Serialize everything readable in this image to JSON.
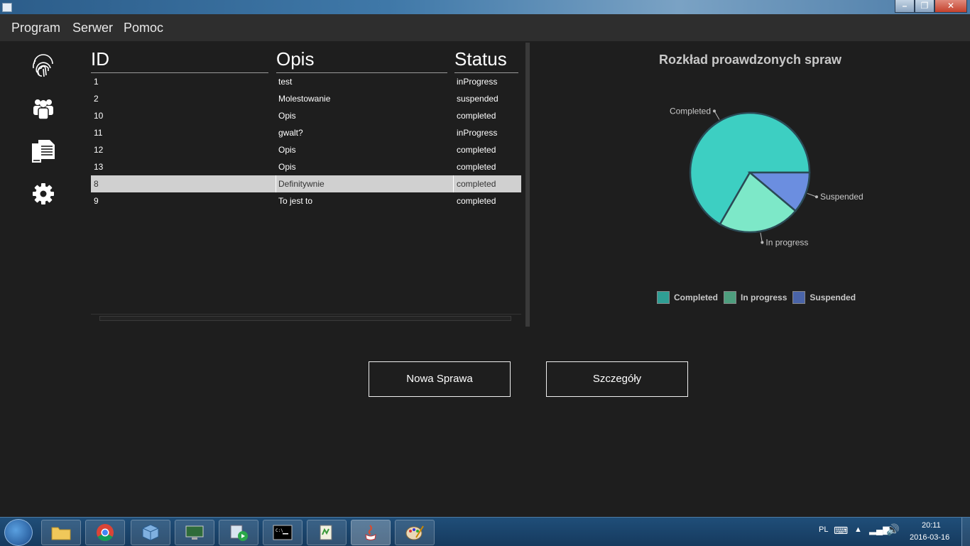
{
  "menu": [
    "Program",
    "Serwer",
    "Pomoc"
  ],
  "table": {
    "headers": [
      "ID",
      "Opis",
      "Status"
    ],
    "rows": [
      {
        "id": "1",
        "opis": "test",
        "status": "inProgress"
      },
      {
        "id": "2",
        "opis": "Molestowanie",
        "status": "suspended"
      },
      {
        "id": "10",
        "opis": "Opis",
        "status": "completed"
      },
      {
        "id": "11",
        "opis": "gwalt?",
        "status": "inProgress"
      },
      {
        "id": "12",
        "opis": "Opis",
        "status": "completed"
      },
      {
        "id": "13",
        "opis": "Opis",
        "status": "completed"
      },
      {
        "id": "8",
        "opis": "Definitywnie",
        "status": "completed",
        "selected": true
      },
      {
        "id": "9",
        "opis": "To jest to",
        "status": "completed"
      }
    ]
  },
  "chart_data": {
    "type": "pie",
    "title": "Rozkład proawdzonych spraw",
    "labels": [
      "Completed",
      "In progress",
      "Suspended"
    ],
    "values": [
      6,
      2,
      1
    ],
    "colors": [
      "#3dcfc2",
      "#7de8c8",
      "#6b8ee0"
    ],
    "legend": [
      "Completed",
      "In progress",
      "Suspended"
    ],
    "legend_colors": [
      "#2f9e94",
      "#4e9e7e",
      "#4a64a8"
    ],
    "legend_placement": "bottom"
  },
  "buttons": {
    "new_case": "Nowa Sprawa",
    "details": "Szczegóły"
  },
  "tray": {
    "language": "PL",
    "time": "20:11",
    "date": "2016-03-16"
  }
}
